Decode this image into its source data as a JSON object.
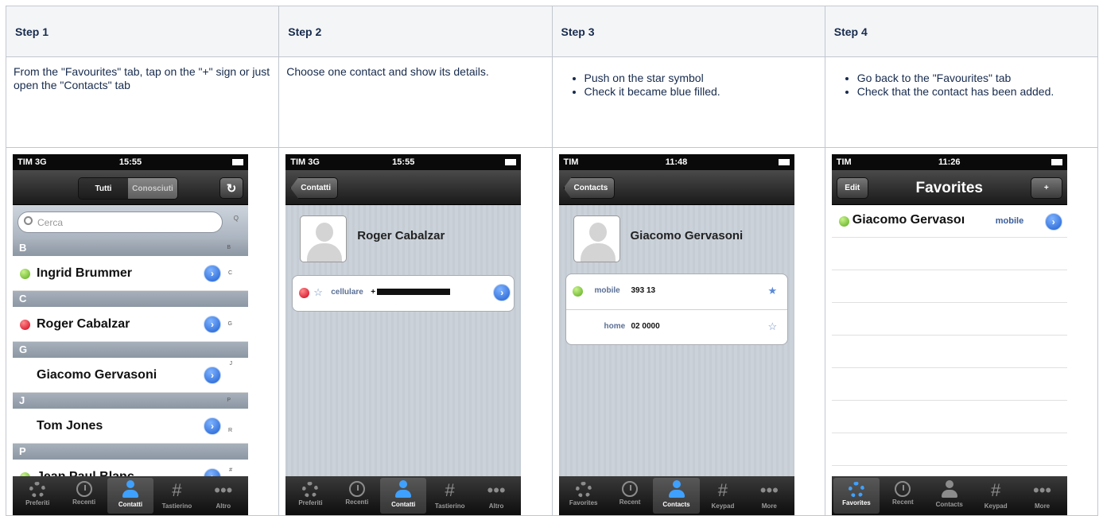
{
  "headers": [
    "Step 1",
    "Step 2",
    "Step 3",
    "Step 4"
  ],
  "step1": {
    "text": "From the \"Favourites\" tab, tap on the \"+\" sign or just open the \"Contacts\" tab"
  },
  "step2": {
    "text": "Choose one contact and show its details."
  },
  "step3": {
    "bullets": [
      "Push on the star symbol",
      "Check it became blue filled."
    ]
  },
  "step4": {
    "bullets": [
      "Go back to the \"Favourites\" tab",
      "Check that the contact has been added."
    ]
  },
  "screen1": {
    "status": {
      "carrier": "TIM 3G",
      "time": "15:55"
    },
    "segments": [
      "Tutti",
      "Conosciuti"
    ],
    "refresh_icon": "refresh-icon",
    "search_placeholder": "Cerca",
    "sections": [
      {
        "letter": "B",
        "contact": "Ingrid Brummer",
        "status": "green",
        "index": "B"
      },
      {
        "letter": "C",
        "contact": "Roger Cabalzar",
        "status": "red",
        "index": "C"
      },
      {
        "letter": "G",
        "contact": "Giacomo Gervasoni",
        "status": "none",
        "index": "G"
      },
      {
        "letter": "J",
        "contact": "Tom Jones",
        "status": "none",
        "index": "J"
      },
      {
        "letter": "P",
        "contact": "Jean Paul Blanc",
        "status": "green",
        "index": "P"
      }
    ],
    "index_letters": [
      "Q",
      "B",
      "C",
      "G",
      "J",
      "P",
      "R",
      "#"
    ],
    "tabs": [
      "Preferiti",
      "Recenti",
      "Contatti",
      "Tastierino",
      "Altro"
    ],
    "active_tab": "Contatti"
  },
  "screen2": {
    "status": {
      "carrier": "TIM 3G",
      "time": "15:55"
    },
    "back": "Contatti",
    "name": "Roger Cabalzar",
    "phone_label": "cellulare",
    "phone_value": "+",
    "tabs": [
      "Preferiti",
      "Recenti",
      "Contatti",
      "Tastierino",
      "Altro"
    ],
    "active_tab": "Contatti"
  },
  "screen3": {
    "status": {
      "carrier": "TIM",
      "time": "11:48"
    },
    "back": "Contacts",
    "name": "Giacomo Gervasoni",
    "rows": [
      {
        "label": "mobile",
        "value": "393 13",
        "starred": true
      },
      {
        "label": "home",
        "value": "02 0000",
        "starred": false
      }
    ],
    "tabs": [
      "Favorites",
      "Recent",
      "Contacts",
      "Keypad",
      "More"
    ],
    "active_tab": "Contacts"
  },
  "screen4": {
    "status": {
      "carrier": "TIM",
      "time": "11:26"
    },
    "edit": "Edit",
    "title": "Favorites",
    "add": "+",
    "favorite": {
      "name": "Giacomo Gervasoı",
      "type": "mobile"
    },
    "tabs": [
      "Favorites",
      "Recent",
      "Contacts",
      "Keypad",
      "More"
    ],
    "active_tab": "Favorites"
  },
  "colors": {
    "accent": "#3fa1ff",
    "green_status": "#5aab1c",
    "red_status": "#d0001c",
    "table_border": "#c1c7d0",
    "header_bg": "#f4f5f7"
  }
}
